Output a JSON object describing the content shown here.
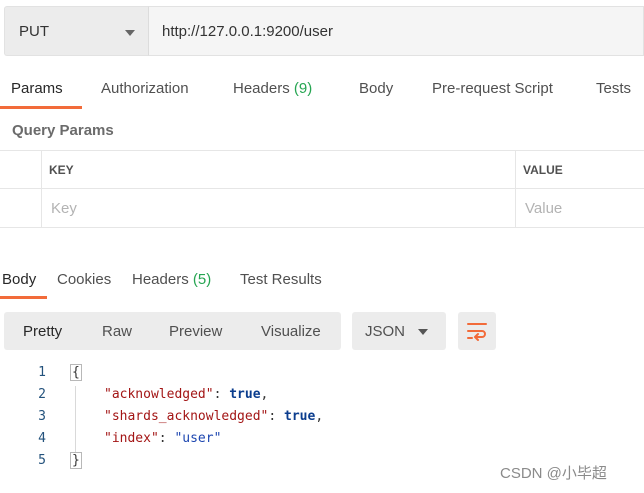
{
  "request": {
    "method": "PUT",
    "url": "http://127.0.0.1:9200/user"
  },
  "request_tabs": [
    {
      "label": "Params",
      "active": true
    },
    {
      "label": "Authorization"
    },
    {
      "label": "Headers",
      "count": "(9)"
    },
    {
      "label": "Body"
    },
    {
      "label": "Pre-request Script"
    },
    {
      "label": "Tests"
    }
  ],
  "params": {
    "title": "Query Params",
    "columns": {
      "key": "KEY",
      "value": "VALUE"
    },
    "key_placeholder": "Key",
    "value_placeholder": "Value"
  },
  "response_tabs": [
    {
      "label": "Body",
      "active": true
    },
    {
      "label": "Cookies"
    },
    {
      "label": "Headers",
      "count": "(5)"
    },
    {
      "label": "Test Results"
    }
  ],
  "view_modes": [
    "Pretty",
    "Raw",
    "Preview",
    "Visualize"
  ],
  "format": "JSON",
  "code_lines": [
    {
      "num": "1",
      "open": "{"
    },
    {
      "num": "2",
      "key": "\"acknowledged\"",
      "sep": ": ",
      "value": "true",
      "end": ","
    },
    {
      "num": "3",
      "key": "\"shards_acknowledged\"",
      "sep": ": ",
      "value": "true",
      "end": ","
    },
    {
      "num": "4",
      "key": "\"index\"",
      "sep": ": ",
      "value": "\"user\"",
      "end": ""
    },
    {
      "num": "5",
      "close": "}"
    }
  ],
  "watermark": "CSDN @小毕超",
  "colors": {
    "accent": "#f26b3a",
    "count": "#26a552"
  }
}
